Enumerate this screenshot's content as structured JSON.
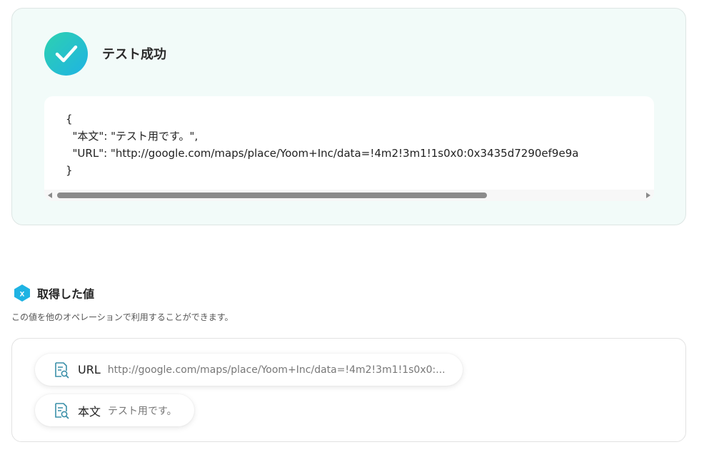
{
  "success": {
    "title": "テスト成功",
    "check_icon": "check-icon",
    "json_lines": [
      "{",
      "  \"本文\": \"テスト用です。\",",
      "  \"URL\": \"http://google.com/maps/place/Yoom+Inc/data=!4m2!3m1!1s0x0:0x3435d7290ef9e9a",
      "}"
    ]
  },
  "values": {
    "icon": "variable-icon",
    "title": "取得した値",
    "description": "この値を他のオペレーションで利用することができます。",
    "items": [
      {
        "label": "URL",
        "value": "http://google.com/maps/place/Yoom+Inc/data=!4m2!3m1!1s0x0:...",
        "icon": "document-search-icon"
      },
      {
        "label": "本文",
        "value": "テスト用です。",
        "icon": "document-search-icon"
      }
    ]
  },
  "colors": {
    "accent_start": "#2dd1b0",
    "accent_end": "#1fb3e3",
    "card_bg": "#f2fbf9"
  }
}
